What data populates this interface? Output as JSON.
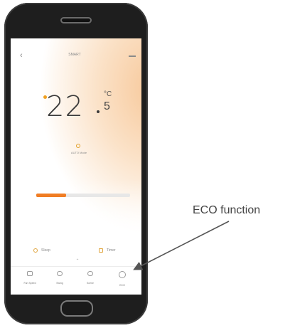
{
  "app": {
    "title": "SMART",
    "temperature": {
      "whole": "22",
      "decimal": "5",
      "unit": "°C"
    },
    "mode_text": "AUTO  Mode",
    "progress_fraction": 0.32
  },
  "quick_actions": [
    {
      "label": "Sleep"
    },
    {
      "label": "Timer"
    }
  ],
  "bottom_bar": [
    {
      "label": "Fan Speed",
      "icon": "calendar-icon"
    },
    {
      "label": "Swing",
      "icon": "swing-icon"
    },
    {
      "label": "Scene",
      "icon": "scene-icon"
    },
    {
      "label": "ECO",
      "icon": "eco-icon"
    }
  ],
  "callout": {
    "label": "ECO function"
  },
  "colors": {
    "accent": "#f07d24",
    "glow": "#f7c89a"
  }
}
